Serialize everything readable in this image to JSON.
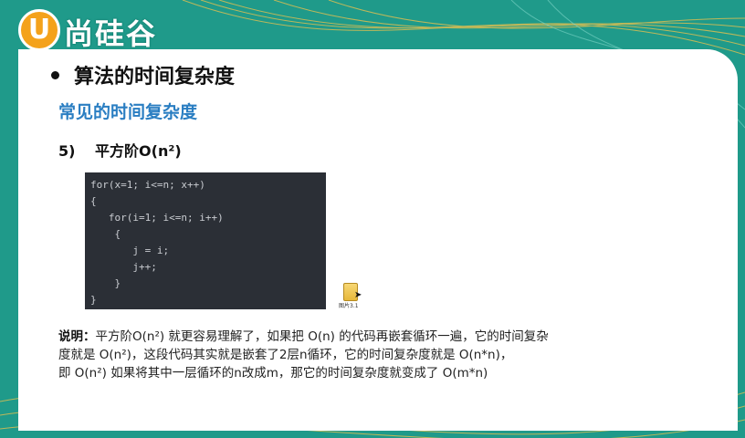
{
  "logo": {
    "mark": "U",
    "text": "尚硅谷"
  },
  "heading": "算法的时间复杂度",
  "subheading": "常见的时间复杂度",
  "item": {
    "number": "5)",
    "label": "平方阶O(n²)"
  },
  "code_lines": [
    "for(x=1; i<=n; x++)",
    "{",
    "   for(i=1; i<=n; i++)",
    "    {",
    "       j = i;",
    "       j++;",
    "    }",
    "}"
  ],
  "file": {
    "label": "图片3.1"
  },
  "description": {
    "prefix": "说明：",
    "line1": "平方阶O(n²) 就更容易理解了，如果把 O(n) 的代码再嵌套循环一遍，它的时间复杂",
    "line2": "度就是 O(n²)，这段代码其实就是嵌套了2层n循环，它的时间复杂度就是 O(n*n)，",
    "line3": "即  O(n²) 如果将其中一层循环的n改成m，那它的时间复杂度就变成了 O(m*n)"
  },
  "colors": {
    "background": "#1f9a8a",
    "accent": "#2a7ec2",
    "logo": "#f4a21b",
    "code_bg": "#2b2f36"
  }
}
